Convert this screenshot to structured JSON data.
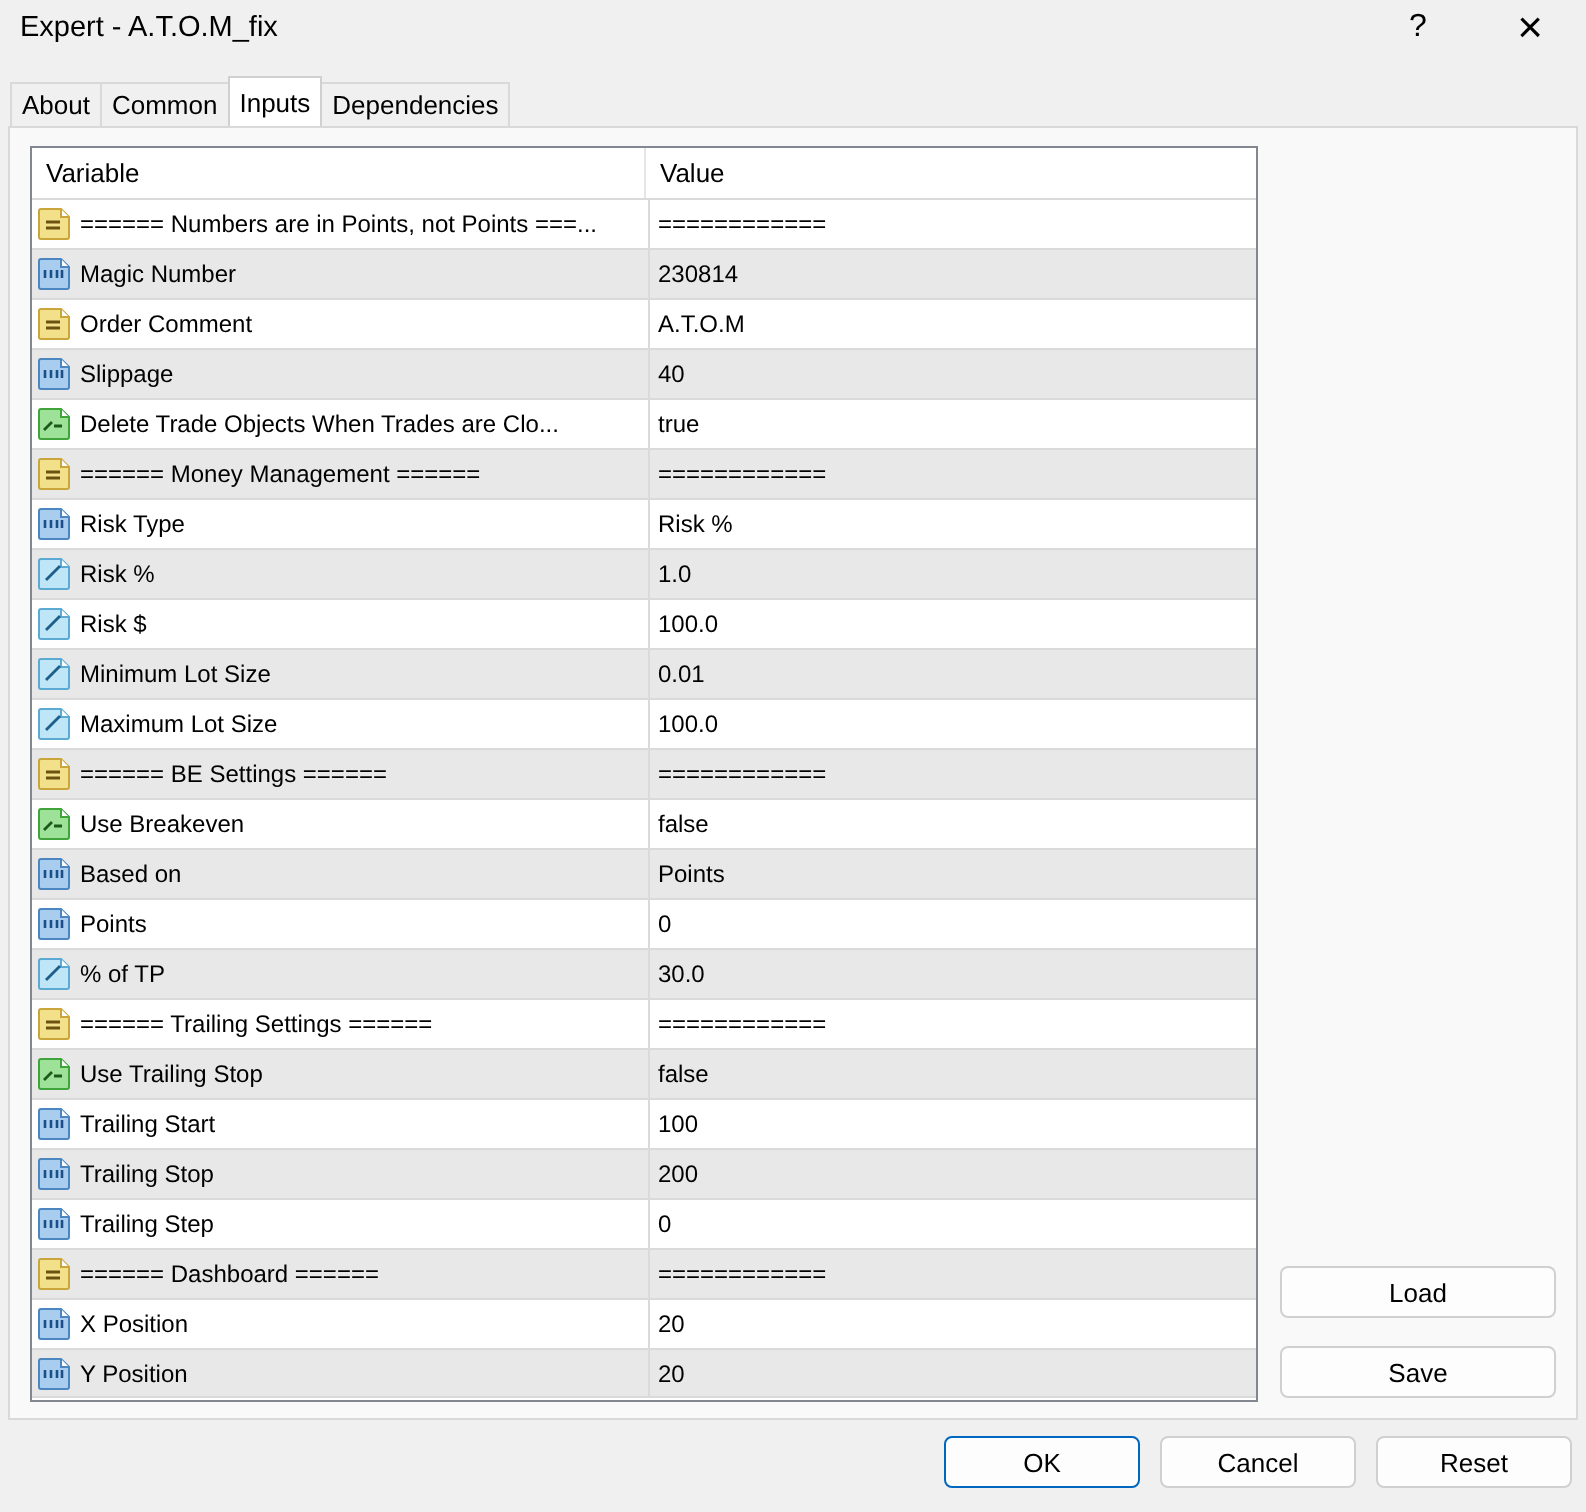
{
  "window": {
    "title": "Expert - A.T.O.M_fix",
    "help": "?",
    "close": "×"
  },
  "tabs": [
    {
      "label": "About",
      "selected": false
    },
    {
      "label": "Common",
      "selected": false
    },
    {
      "label": "Inputs",
      "selected": true
    },
    {
      "label": "Dependencies",
      "selected": false
    }
  ],
  "table": {
    "columns": [
      "Variable",
      "Value"
    ],
    "rows": [
      {
        "kind": "string",
        "variable": "====== Numbers are in Points, not Points ===...",
        "value": "============"
      },
      {
        "kind": "int",
        "variable": "Magic Number",
        "value": "230814"
      },
      {
        "kind": "string",
        "variable": "Order Comment",
        "value": "A.T.O.M"
      },
      {
        "kind": "int",
        "variable": "Slippage",
        "value": "40"
      },
      {
        "kind": "bool",
        "variable": "Delete Trade Objects When Trades are Clo...",
        "value": "true"
      },
      {
        "kind": "string",
        "variable": "====== Money Management ======",
        "value": "============"
      },
      {
        "kind": "int",
        "variable": "Risk Type",
        "value": "Risk %"
      },
      {
        "kind": "double",
        "variable": "Risk %",
        "value": "1.0"
      },
      {
        "kind": "double",
        "variable": "Risk $",
        "value": "100.0"
      },
      {
        "kind": "double",
        "variable": "Minimum Lot Size",
        "value": "0.01"
      },
      {
        "kind": "double",
        "variable": "Maximum Lot Size",
        "value": "100.0"
      },
      {
        "kind": "string",
        "variable": "====== BE Settings ======",
        "value": "============"
      },
      {
        "kind": "bool",
        "variable": "Use Breakeven",
        "value": "false"
      },
      {
        "kind": "int",
        "variable": "Based on",
        "value": "Points"
      },
      {
        "kind": "int",
        "variable": "Points",
        "value": "0"
      },
      {
        "kind": "double",
        "variable": "% of TP",
        "value": "30.0"
      },
      {
        "kind": "string",
        "variable": "====== Trailing Settings ======",
        "value": "============"
      },
      {
        "kind": "bool",
        "variable": "Use Trailing Stop",
        "value": "false"
      },
      {
        "kind": "int",
        "variable": "Trailing Start",
        "value": "100"
      },
      {
        "kind": "int",
        "variable": "Trailing Stop",
        "value": "200"
      },
      {
        "kind": "int",
        "variable": "Trailing Step",
        "value": "0"
      },
      {
        "kind": "string",
        "variable": "====== Dashboard ======",
        "value": "============"
      },
      {
        "kind": "int",
        "variable": "X Position",
        "value": "20"
      },
      {
        "kind": "int",
        "variable": "Y Position",
        "value": "20"
      }
    ]
  },
  "side_buttons": [
    "Load",
    "Save"
  ],
  "buttons": [
    {
      "label": "OK",
      "kind": "default"
    },
    {
      "label": "Cancel",
      "kind": "normal"
    },
    {
      "label": "Reset",
      "kind": "normal"
    }
  ]
}
